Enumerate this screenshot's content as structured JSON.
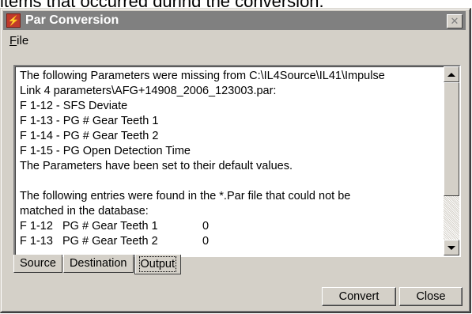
{
  "caption": "items that occurred during the conversion.",
  "window": {
    "title": "Par Conversion",
    "close_glyph": "✕"
  },
  "menu": {
    "file": "File"
  },
  "output_text": "The following Parameters were missing from C:\\IL4Source\\IL41\\Impulse\nLink 4 parameters\\AFG+14908_2006_123003.par:\nF 1-12 - SFS Deviate\nF 1-13 - PG # Gear Teeth 1\nF 1-14 - PG # Gear Teeth 2\nF 1-15 - PG Open Detection Time\nThe Parameters have been set to their default values.\n\nThe following entries were found in the *.Par file that could not be\nmatched in the database:\nF 1-12   PG # Gear Teeth 1              0\nF 1-13   PG # Gear Teeth 2              0",
  "tabs": [
    "Source",
    "Destination",
    "Output"
  ],
  "buttons": {
    "convert": "Convert",
    "close": "Close"
  },
  "colors": {
    "title_bar_inactive": "#808080",
    "face": "#d4d0c8"
  },
  "icons": {
    "app": "lightning-bolt-icon",
    "close": "close-icon"
  }
}
